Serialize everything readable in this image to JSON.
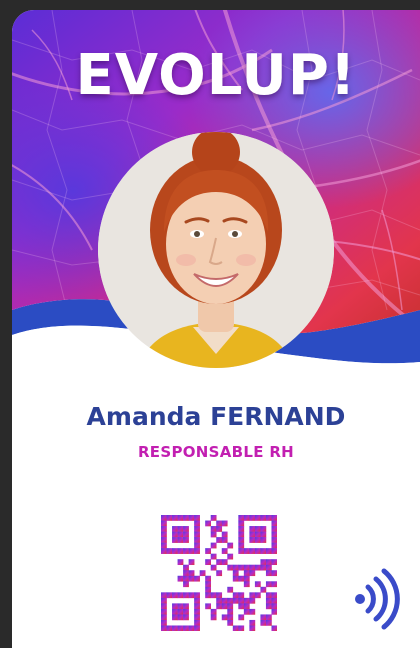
{
  "badge": {
    "company": "EVOLUP!",
    "employee_name": "Amanda FERNAND",
    "job_title": "RESPONSABLE RH"
  },
  "colors": {
    "name": "#2c4196",
    "title": "#c21fb1",
    "wave": "#2b4cc3",
    "hero_purple": "#7b2bd9",
    "hero_magenta": "#d02a8e",
    "hero_red": "#e0383e"
  },
  "icons": {
    "photo": "employee-photo",
    "qr": "qr-code-icon",
    "contactless": "nfc-icon"
  }
}
